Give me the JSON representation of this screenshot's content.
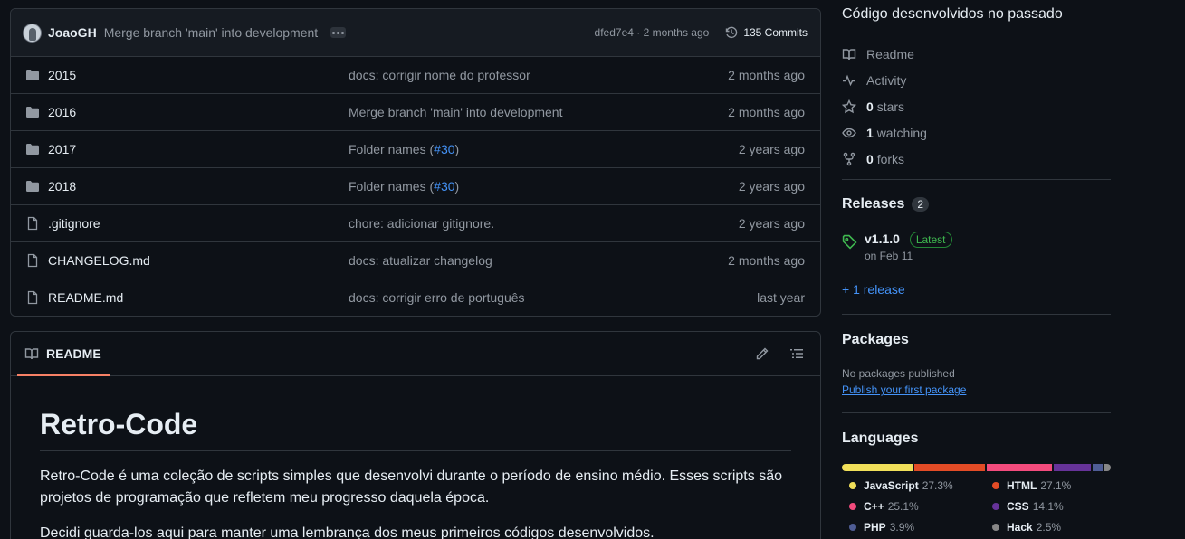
{
  "commit_bar": {
    "author": "JoaoGH",
    "message": "Merge branch 'main' into development",
    "meta": "dfed7e4 · 2 months ago",
    "commits_label": "135 Commits"
  },
  "files": [
    {
      "name": "2015",
      "type": "folder",
      "commit": "docs: corrigir nome do professor",
      "age": "2 months ago"
    },
    {
      "name": "2016",
      "type": "folder",
      "commit": "Merge branch 'main' into development",
      "age": "2 months ago"
    },
    {
      "name": "2017",
      "type": "folder",
      "commit": "Folder names (",
      "issue": "#30",
      "commit_tail": ")",
      "age": "2 years ago"
    },
    {
      "name": "2018",
      "type": "folder",
      "commit": "Folder names (",
      "issue": "#30",
      "commit_tail": ")",
      "age": "2 years ago"
    },
    {
      "name": ".gitignore",
      "type": "file",
      "commit": "chore: adicionar gitignore.",
      "age": "2 years ago"
    },
    {
      "name": "CHANGELOG.md",
      "type": "file",
      "commit": "docs: atualizar changelog",
      "age": "2 months ago"
    },
    {
      "name": "README.md",
      "type": "file",
      "commit": "docs: corrigir erro de português",
      "age": "last year"
    }
  ],
  "readme": {
    "tab_label": "README",
    "title": "Retro-Code",
    "paragraph1": "Retro-Code é uma coleção de scripts simples que desenvolvi durante o período de ensino médio. Esses scripts são projetos de programação que refletem meu progresso daquela época.",
    "paragraph2": "Decidi guarda-los aqui para manter uma lembrança dos meus primeiros códigos desenvolvidos."
  },
  "sidebar": {
    "about": "Código desenvolvidos no passado",
    "readme_label": "Readme",
    "activity_label": "Activity",
    "stars_count": "0",
    "stars_label": "stars",
    "watching_count": "1",
    "watching_label": "watching",
    "forks_count": "0",
    "forks_label": "forks",
    "releases_title": "Releases",
    "releases_count": "2",
    "release_name": "v1.1.0",
    "release_badge": "Latest",
    "release_date": "on Feb 11",
    "more_releases": "+ 1 release",
    "packages_title": "Packages",
    "packages_empty": "No packages published",
    "packages_link": "Publish your first package",
    "languages_title": "Languages",
    "languages": [
      {
        "name": "JavaScript",
        "percent": "27.3%",
        "value": 27.3,
        "color": "#f1e05a"
      },
      {
        "name": "HTML",
        "percent": "27.1%",
        "value": 27.1,
        "color": "#e34c26"
      },
      {
        "name": "C++",
        "percent": "25.1%",
        "value": 25.1,
        "color": "#f34b7d"
      },
      {
        "name": "CSS",
        "percent": "14.1%",
        "value": 14.1,
        "color": "#663399"
      },
      {
        "name": "PHP",
        "percent": "3.9%",
        "value": 3.9,
        "color": "#4F5D95"
      },
      {
        "name": "Hack",
        "percent": "2.5%",
        "value": 2.5,
        "color": "#878787"
      }
    ]
  }
}
